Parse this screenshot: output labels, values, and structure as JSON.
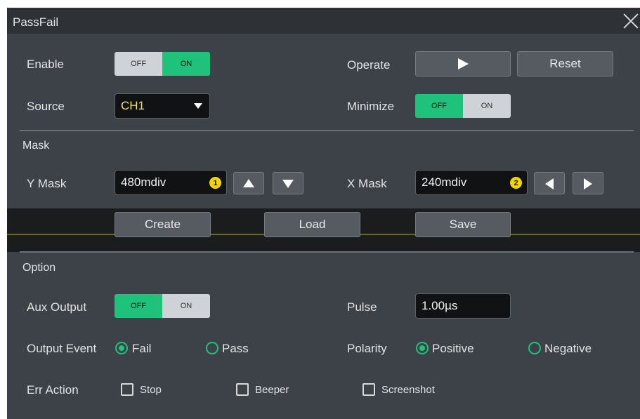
{
  "window": {
    "title": "PassFail"
  },
  "enable": {
    "label": "Enable",
    "off": "OFF",
    "on": "ON"
  },
  "operate": {
    "label": "Operate",
    "reset": "Reset"
  },
  "source": {
    "label": "Source",
    "value": "CH1"
  },
  "minimize": {
    "label": "Minimize",
    "off": "OFF",
    "on": "ON"
  },
  "mask": {
    "section": "Mask",
    "y_label": "Y Mask",
    "y_value": "480mdiv",
    "y_badge": "1",
    "x_label": "X Mask",
    "x_value": "240mdiv",
    "x_badge": "2",
    "create": "Create",
    "load": "Load",
    "save": "Save"
  },
  "option": {
    "section": "Option",
    "aux_label": "Aux Output",
    "aux_off": "OFF",
    "aux_on": "ON",
    "pulse_label": "Pulse",
    "pulse_value": "1.00µs",
    "event_label": "Output Event",
    "event_fail": "Fail",
    "event_pass": "Pass",
    "event_selected": "Fail",
    "polarity_label": "Polarity",
    "polarity_pos": "Positive",
    "polarity_neg": "Negative",
    "polarity_selected": "Positive",
    "err_label": "Err Action",
    "err_stop": "Stop",
    "err_beeper": "Beeper",
    "err_screenshot": "Screenshot"
  },
  "colors": {
    "accent": "#1ec27a",
    "panel": "#3d4249",
    "badge": "#f2d500"
  }
}
